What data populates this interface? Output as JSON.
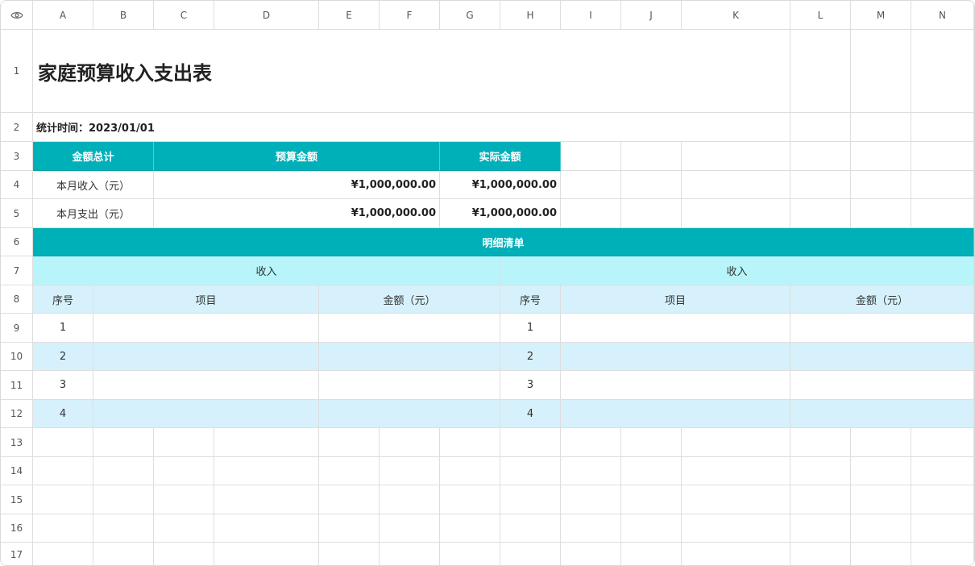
{
  "columns": [
    "A",
    "B",
    "C",
    "D",
    "E",
    "F",
    "G",
    "H",
    "I",
    "J",
    "K",
    "L",
    "M",
    "N"
  ],
  "rows": [
    "1",
    "2",
    "3",
    "4",
    "5",
    "6",
    "7",
    "8",
    "9",
    "10",
    "11",
    "12",
    "13",
    "14",
    "15",
    "16",
    "17"
  ],
  "title": "家庭预算收入支出表",
  "date_label": "统计时间：2023/01/01",
  "summary": {
    "headers": [
      "金额总计",
      "预算金额",
      "实际金额"
    ],
    "rows": [
      {
        "label": "本月收入（元）",
        "budget": "¥1,000,000.00",
        "actual": "¥1,000,000.00"
      },
      {
        "label": "本月支出（元）",
        "budget": "¥1,000,000.00",
        "actual": "¥1,000,000.00"
      }
    ]
  },
  "detail": {
    "title": "明细清单",
    "left_section": "收入",
    "right_section": "收入",
    "headers": [
      "序号",
      "项目",
      "金额（元）"
    ],
    "numbers": [
      "1",
      "2",
      "3",
      "4"
    ]
  },
  "colors": {
    "teal": "#00b0b9",
    "light_cyan": "#b7f5fa",
    "light_blue": "#d6f1fb"
  },
  "icons": {
    "corner": "eye-icon"
  }
}
